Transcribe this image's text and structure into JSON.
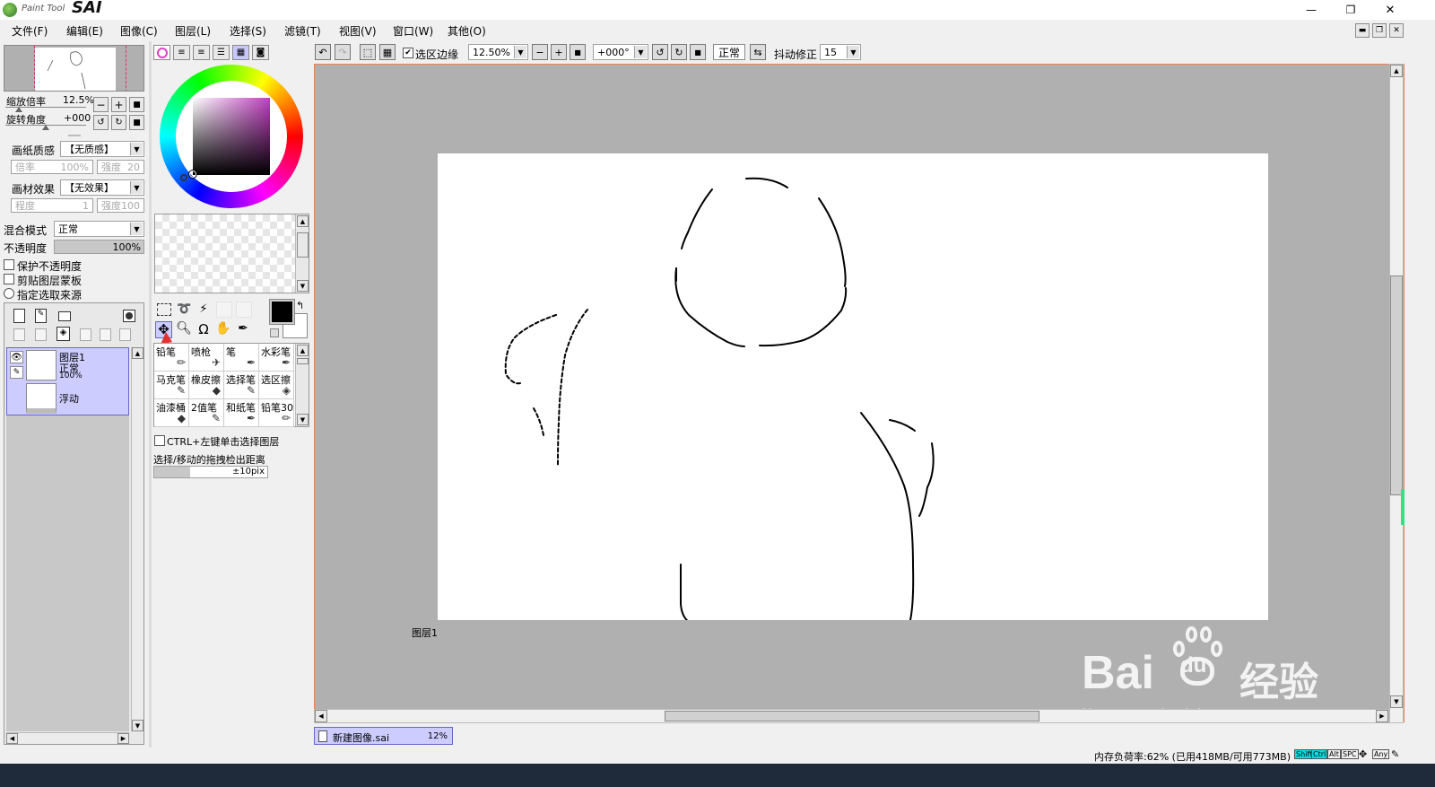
{
  "app": {
    "logo_small": "Paint Tool",
    "logo_big": "SAI"
  },
  "window_controls": {
    "minimize": "—",
    "restore": "❐",
    "close": "✕"
  },
  "menu": [
    {
      "label": "文件(F)"
    },
    {
      "label": "编辑(E)"
    },
    {
      "label": "图像(C)"
    },
    {
      "label": "图层(L)"
    },
    {
      "label": "选择(S)"
    },
    {
      "label": "滤镜(T)"
    },
    {
      "label": "视图(V)"
    },
    {
      "label": "窗口(W)"
    },
    {
      "label": "其他(O)"
    }
  ],
  "navigator": {
    "zoom_label": "缩放倍率",
    "zoom_value": "12.5%",
    "rotate_label": "旋转角度",
    "rotate_value": "+000"
  },
  "texture": {
    "paper_label": "画纸质感",
    "paper_value": "【无质感】",
    "paper_scale_label": "倍率",
    "paper_scale_value": "100%",
    "paper_strength_label": "强度",
    "paper_strength_value": "20",
    "effect_label": "画材效果",
    "effect_value": "【无效果】",
    "effect_degree_label": "程度",
    "effect_degree_value": "1",
    "effect_strength_label": "强度",
    "effect_strength_value": "100"
  },
  "layer_props": {
    "blend_label": "混合模式",
    "blend_value": "正常",
    "opacity_label": "不透明度",
    "opacity_value": "100%",
    "opacity_fraction": 1.0,
    "protect_opacity": "保护不透明度",
    "clip_mask": "剪贴图层蒙板",
    "selection_source": "指定选取来源"
  },
  "layers": [
    {
      "name": "图层1",
      "mode": "正常",
      "opacity": "100%"
    },
    {
      "name": "浮动"
    }
  ],
  "tools": {
    "brushes": [
      {
        "label": "铅笔"
      },
      {
        "label": "喷枪"
      },
      {
        "label": "笔"
      },
      {
        "label": "水彩笔"
      },
      {
        "label": "马克笔"
      },
      {
        "label": "橡皮擦"
      },
      {
        "label": "选择笔"
      },
      {
        "label": "选区擦"
      },
      {
        "label": "油漆桶"
      },
      {
        "label": "2值笔"
      },
      {
        "label": "和纸笔"
      },
      {
        "label": "铅笔30"
      }
    ],
    "ctrl_click_label": "CTRL+左键单击选择图层",
    "drag_label": "选择/移动的拖拽检出距离",
    "drag_value": "±10pix"
  },
  "toolbar": {
    "selection_edge_label": "选区边缘",
    "zoom_value": "12.50%",
    "angle_value": "+000°",
    "mode_value": "正常",
    "stabilizer_label": "抖动修正",
    "stabilizer_value": "15"
  },
  "canvas": {
    "layer_label": "图层1"
  },
  "watermark": {
    "brand": "Bai",
    "brand2": "du",
    "cn": "经验",
    "url": "jingyan.baidu.com"
  },
  "document_tab": {
    "name": "新建图像.sai",
    "zoom": "12%"
  },
  "status": {
    "memory": "内存负荷率:62% (已用418MB/可用773MB)",
    "keys": [
      "Shift",
      "Ctrl",
      "Alt",
      "SPC",
      "Any"
    ]
  },
  "colors": {
    "accent": "#f08050",
    "selection_blue": "#ccccff",
    "canvas_gray": "#b0b0b0"
  }
}
